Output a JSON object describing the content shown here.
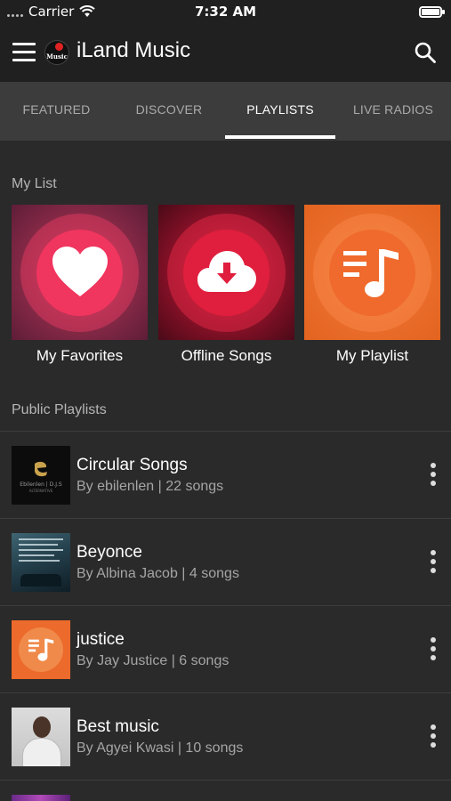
{
  "status": {
    "carrier": "Carrier",
    "time": "7:32 AM"
  },
  "app": {
    "title": "iLand Music",
    "logo_text": "Music"
  },
  "tabs": [
    {
      "label": "FEATURED",
      "active": false
    },
    {
      "label": "DISCOVER",
      "active": false
    },
    {
      "label": "PLAYLISTS",
      "active": true
    },
    {
      "label": "LIVE RADIOS",
      "active": false
    }
  ],
  "my_list": {
    "title": "My List",
    "items": [
      {
        "label": "My Favorites",
        "icon": "heart-icon"
      },
      {
        "label": "Offline Songs",
        "icon": "cloud-download-icon"
      },
      {
        "label": "My Playlist",
        "icon": "playlist-icon"
      }
    ]
  },
  "public_playlists": {
    "title": "Public Playlists",
    "items": [
      {
        "name": "Circular Songs",
        "meta": "By ebilenlen | 22 songs",
        "thumb_text": "Ebilenlen | D.J.S",
        "thumb_subtext": "ALTERNATIVE"
      },
      {
        "name": "Beyonce",
        "meta": "By Albina Jacob | 4 songs"
      },
      {
        "name": "justice",
        "meta": "By Jay Justice | 6 songs"
      },
      {
        "name": "Best music",
        "meta": "By Agyei Kwasi | 10 songs"
      }
    ]
  },
  "colors": {
    "accent_orange": "#ef6a2c",
    "heart_pink": "#f0355f",
    "cloud_red": "#e01e3d"
  }
}
